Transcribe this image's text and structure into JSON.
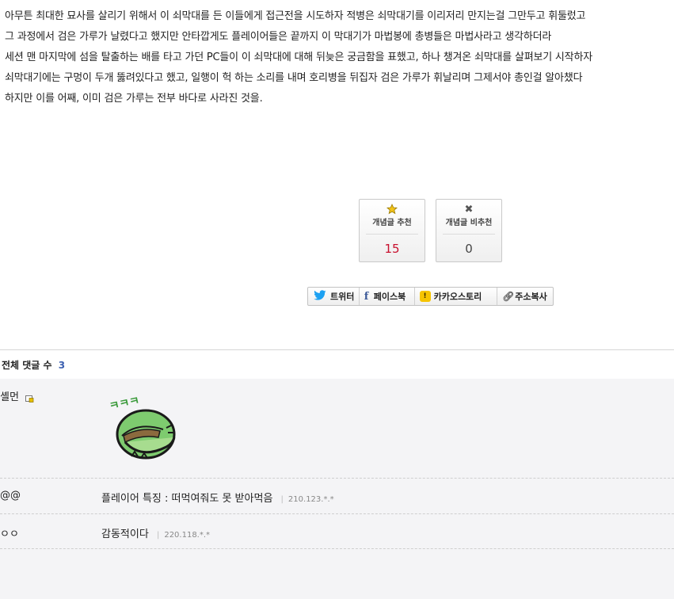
{
  "article": {
    "lines": [
      "아무튼 최대한 묘사를 살리기 위해서 이 쇠막대를 든 이들에게 접근전을 시도하자 적병은 쇠막대기를 이리저리 만지는걸 그만두고 휘둘렀고",
      "그 과정에서 검은 가루가 날렸다고 했지만 안타깝게도 플레이어들은 끝까지 이 막대기가 마법봉에 총병들은 마법사라고 생각하더라",
      "세션 맨 마지막에 섬을 탈출하는 배를 타고 가던 PC들이 이 쇠막대에 대해 뒤늦은 궁금함을 표했고, 하나 챙겨온 쇠막대를 살펴보기 시작하자",
      "쇠막대기에는 구멍이 두개 뚫려있다고 했고, 일행이 헉 하는 소리를 내며 호리병을 뒤집자 검은 가루가 휘날리며 그제서야 총인걸 알아챘다",
      "하지만 이를 어째, 이미 검은 가루는 전부 바다로 사라진 것을."
    ]
  },
  "votes": {
    "up": {
      "label": "개념글 추천",
      "count": "15",
      "icon": "star-icon"
    },
    "down": {
      "label": "개념글 비추천",
      "count": "0",
      "icon": "x-icon"
    }
  },
  "share": {
    "twitter": "트위터",
    "facebook": "페이스북",
    "kakaostory": "카카오스토리",
    "copy_url": "주소복사"
  },
  "comments": {
    "header_label": "전체 댓글 수",
    "count": "3",
    "items": [
      {
        "name": "셸먼",
        "text": "",
        "ip": ""
      },
      {
        "name": "@@",
        "text": "플레이어 특징 : 떠먹여줘도 못 받아먹음",
        "ip": "210.123.*.*"
      },
      {
        "name": "ㅇㅇ",
        "text": "감동적이다",
        "ip": "220.118.*.*"
      }
    ],
    "sticker_text": "ㅋㅋㅋ"
  },
  "colors": {
    "recommend_count": "#c8102e",
    "comment_count": "#3b5fb0",
    "facebook": "#3b5998",
    "kakao": "#f6c400",
    "twitter": "#1da1f2",
    "sticker_green": "#7ecb6f"
  }
}
